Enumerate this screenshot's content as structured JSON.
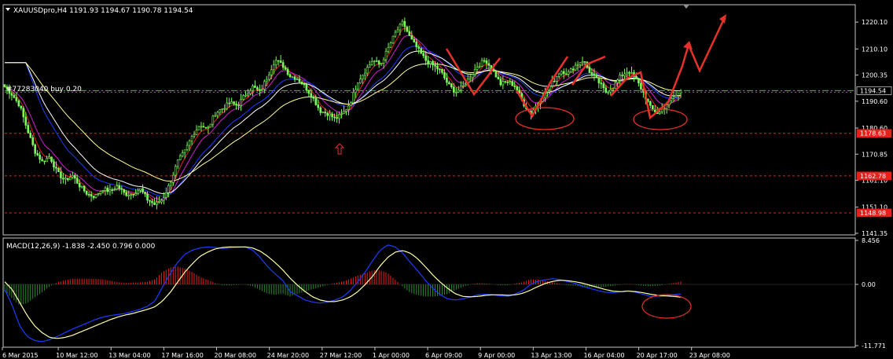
{
  "header": {
    "symbol_line": "XAUUSDpro,H4  1191.93 1194.67 1190.78 1194.54",
    "order_line": "#77283040 buy 0.20"
  },
  "indicator": {
    "label": "MACD(12,26,9) -1.838 -2.450 0.796 0.000"
  },
  "price_axis": {
    "ticks": [
      "1220.10",
      "1210.10",
      "1200.35",
      "1190.60",
      "1180.60",
      "1170.85",
      "1161.10",
      "1151.10",
      "1141.35"
    ],
    "min": 1141.35,
    "max": 1226.0
  },
  "macd_axis": {
    "ticks": [
      "8.456",
      "0.00",
      "-11.771"
    ],
    "min": -11.771,
    "max": 8.456
  },
  "time_axis": {
    "ticks": [
      "6 Mar 2015",
      "10 Mar 12:00",
      "13 Mar 04:00",
      "17 Mar 16:00",
      "20 Mar 08:00",
      "24 Mar 20:00",
      "27 Mar 12:00",
      "1 Apr 00:00",
      "6 Apr 09:00",
      "9 Apr 00:00",
      "13 Apr 13:00",
      "16 Apr 04:00",
      "20 Apr 17:00",
      "23 Apr 08:00"
    ]
  },
  "price_tags": [
    {
      "value": 1194.54,
      "text": "1194.54",
      "color": "#ffffff",
      "bg": "#000000"
    },
    {
      "value": 1178.63,
      "text": "1178.63",
      "color": "#000000",
      "bg": "#e8201a"
    },
    {
      "value": 1162.78,
      "text": "1162.78",
      "color": "#000000",
      "bg": "#e8201a"
    },
    {
      "value": 1148.98,
      "text": "1148.98",
      "color": "#000000",
      "bg": "#e8201a"
    }
  ],
  "colors": {
    "candles": "#7cfc5a",
    "ma_fast": "#e8201a",
    "ma_mid": "#d11fd1",
    "ma_slow": "#1a3cff",
    "ma_white": "#ffffff",
    "ma_yellow": "#ffff99",
    "support": "#e8201a",
    "annotation": "#e8302a",
    "macd_line": "#1a3cff",
    "signal_line": "#ffffaa",
    "hist_pos": "#e8201a",
    "hist_neg": "#2e8b2e"
  },
  "chart_data": {
    "type": "candlestick",
    "title": "XAUUSDpro,H4",
    "ohlc_last": {
      "open": 1191.93,
      "high": 1194.67,
      "low": 1190.78,
      "close": 1194.54
    },
    "close_path": [
      1196,
      1193,
      1189,
      1180,
      1172,
      1168,
      1170,
      1164,
      1161,
      1163,
      1159,
      1156,
      1155,
      1158,
      1157,
      1159,
      1156,
      1156,
      1158,
      1154,
      1152,
      1154,
      1160,
      1168,
      1172,
      1178,
      1182,
      1180,
      1186,
      1188,
      1190,
      1189,
      1193,
      1196,
      1194,
      1200,
      1206,
      1204,
      1200,
      1199,
      1196,
      1192,
      1187,
      1186,
      1184,
      1186,
      1190,
      1198,
      1202,
      1206,
      1204,
      1210,
      1216,
      1220,
      1214,
      1210,
      1206,
      1204,
      1202,
      1197,
      1194,
      1196,
      1200,
      1204,
      1206,
      1202,
      1197,
      1198,
      1196,
      1190,
      1186,
      1190,
      1194,
      1198,
      1202,
      1201,
      1204,
      1206,
      1201,
      1198,
      1194,
      1196,
      1200,
      1202,
      1199,
      1194,
      1188,
      1186,
      1189,
      1192,
      1194
    ],
    "macd_path": [
      -1,
      -4,
      -8,
      -10,
      -10.8,
      -11,
      -10.6,
      -10,
      -9.3,
      -8.6,
      -8,
      -7.4,
      -6.8,
      -6.3,
      -6,
      -5.8,
      -5.6,
      -5.2,
      -4.8,
      -4.2,
      -3.2,
      -0.5,
      2,
      4.2,
      5.8,
      6.6,
      7,
      7.2,
      7.1,
      6.9,
      7,
      7.1,
      7.2,
      6.6,
      5.2,
      3.4,
      2,
      0.8,
      -1.4,
      -2.2,
      -3,
      -3.4,
      -3.6,
      -3.4,
      -3,
      -2.4,
      -1.2,
      0.5,
      2.4,
      4.6,
      6.6,
      7.6,
      7.2,
      6,
      4.2,
      2.6,
      0.8,
      -0.8,
      -2,
      -2.8,
      -3,
      -2.8,
      -2.4,
      -2,
      -1.9,
      -2,
      -2.2,
      -2.3,
      -1.8,
      -1.2,
      0,
      0.6,
      0.9,
      1.1,
      0.9,
      0.5,
      0.2,
      -0.4,
      -0.8,
      -1.2,
      -1.5,
      -1.6,
      -1.4,
      -1.2,
      -1.5,
      -1.9,
      -2.3,
      -2.4,
      -2.2,
      -2.0,
      -1.84
    ],
    "signal_path": [
      0.5,
      -1,
      -3.5,
      -6,
      -8,
      -9.3,
      -10.2,
      -10.4,
      -10.2,
      -9.8,
      -9.2,
      -8.6,
      -8,
      -7.4,
      -6.8,
      -6.3,
      -5.9,
      -5.6,
      -5.2,
      -4.8,
      -4.3,
      -3.2,
      -1.6,
      0.4,
      2.4,
      4,
      5.4,
      6.2,
      6.8,
      7.1,
      7.2,
      7.2,
      7.2,
      7,
      6.4,
      5.4,
      4.2,
      2.8,
      1.2,
      -0.2,
      -1.4,
      -2.4,
      -3,
      -3.3,
      -3.3,
      -3,
      -2.4,
      -1.4,
      0,
      1.6,
      3.6,
      5.2,
      6.2,
      6.5,
      6,
      4.9,
      3.4,
      1.8,
      0.4,
      -0.8,
      -1.8,
      -2.3,
      -2.4,
      -2.3,
      -2.1,
      -2.0,
      -2.0,
      -2.1,
      -2.0,
      -1.7,
      -1.1,
      -0.4,
      0.2,
      0.6,
      0.8,
      0.7,
      0.5,
      0.2,
      -0.2,
      -0.6,
      -1.0,
      -1.3,
      -1.4,
      -1.3,
      -1.4,
      -1.6,
      -1.9,
      -2.1,
      -2.2,
      -2.3,
      -2.45
    ],
    "support_levels": [
      1178.63,
      1162.78,
      1148.98
    ],
    "order_level": 1194.54,
    "ylim_price": [
      1141.35,
      1226.0
    ],
    "ylim_macd": [
      -11.771,
      8.456
    ]
  }
}
